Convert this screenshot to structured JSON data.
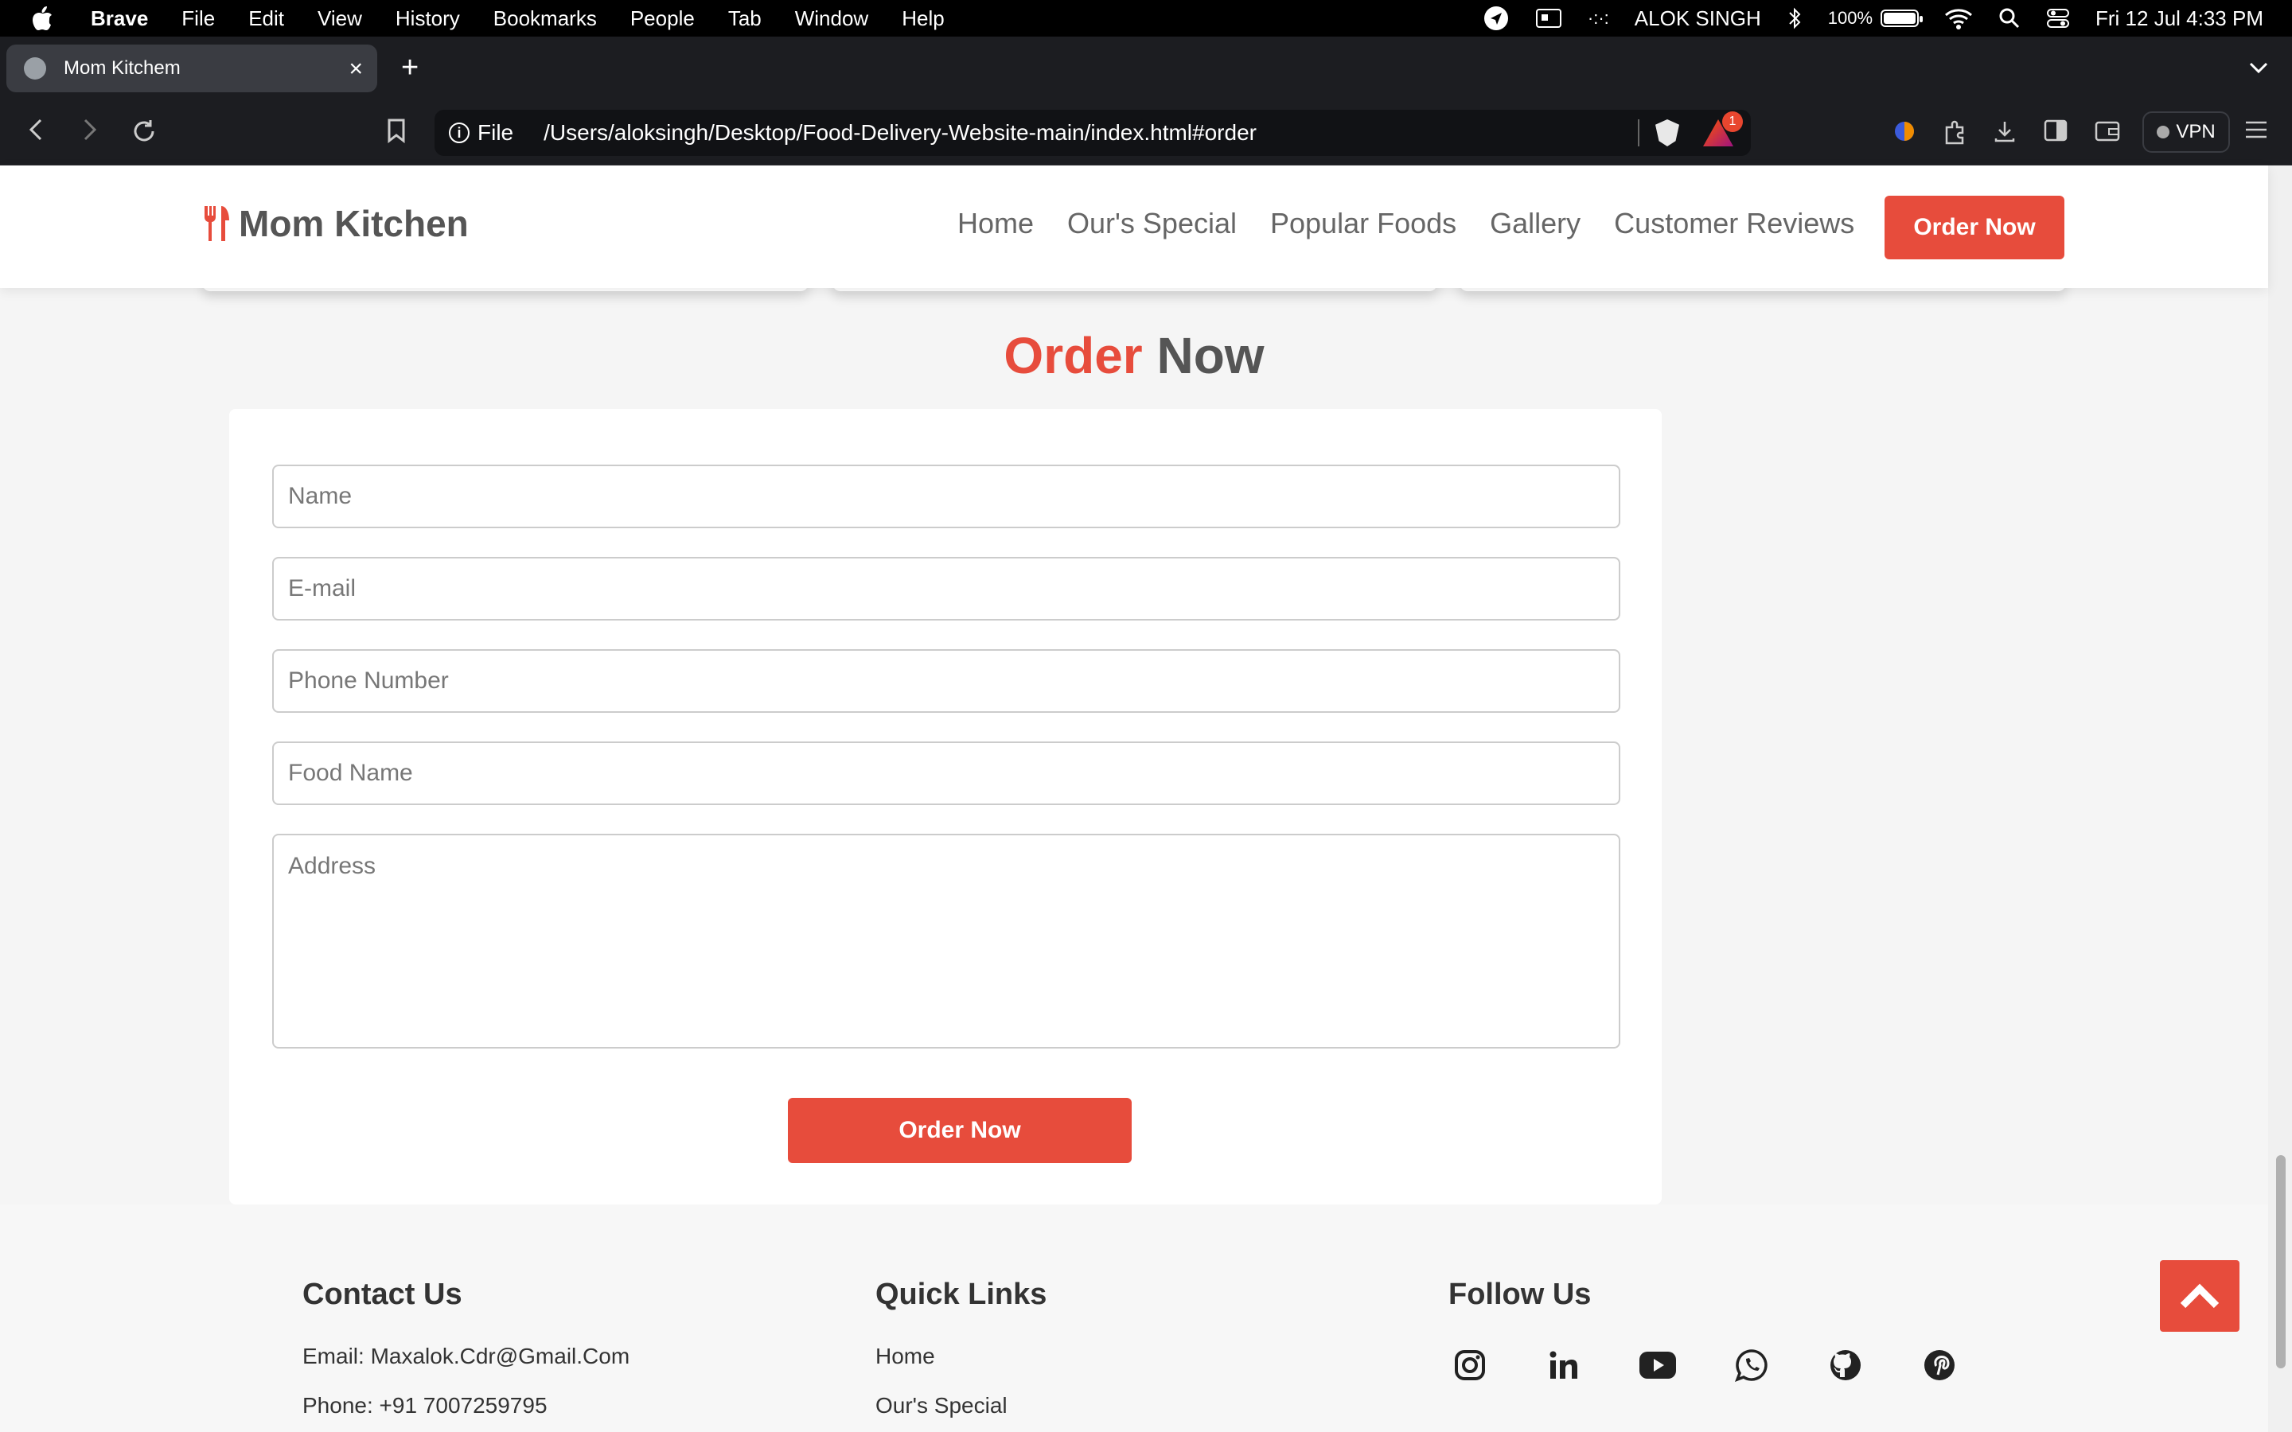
{
  "menubar": {
    "app": "Brave",
    "items": [
      "File",
      "Edit",
      "View",
      "History",
      "Bookmarks",
      "People",
      "Tab",
      "Window",
      "Help"
    ],
    "user": "ALOK SINGH",
    "battery": "100%",
    "datetime": "Fri 12 Jul  4:33 PM"
  },
  "browser": {
    "tab_title": "Mom Kitchem",
    "url_scheme": "File",
    "url": "/Users/aloksingh/Desktop/Food-Delivery-Website-main/index.html#order",
    "rewards_badge": "1",
    "vpn_label": "VPN"
  },
  "site": {
    "logo": "Mom Kitchen",
    "nav": [
      "Home",
      "Our's Special",
      "Popular Foods",
      "Gallery",
      "Customer Reviews"
    ],
    "header_button": "Order Now"
  },
  "order": {
    "title_accent": "Order",
    "title_rest": "Now",
    "fields": {
      "name": "Name",
      "email": "E-mail",
      "phone": "Phone Number",
      "food": "Food Name",
      "address": "Address"
    },
    "submit": "Order Now"
  },
  "footer": {
    "contact": {
      "heading": "Contact Us",
      "email": "Email: Maxalok.Cdr@Gmail.Com",
      "phone": "Phone: +91 7007259795"
    },
    "links": {
      "heading": "Quick Links",
      "items": [
        "Home",
        "Our's Special"
      ]
    },
    "follow": {
      "heading": "Follow Us",
      "icons": [
        "instagram-icon",
        "linkedin-icon",
        "youtube-icon",
        "whatsapp-icon",
        "github-icon",
        "pinterest-icon"
      ]
    }
  },
  "colors": {
    "accent": "#e74c3c",
    "text": "#555555"
  }
}
